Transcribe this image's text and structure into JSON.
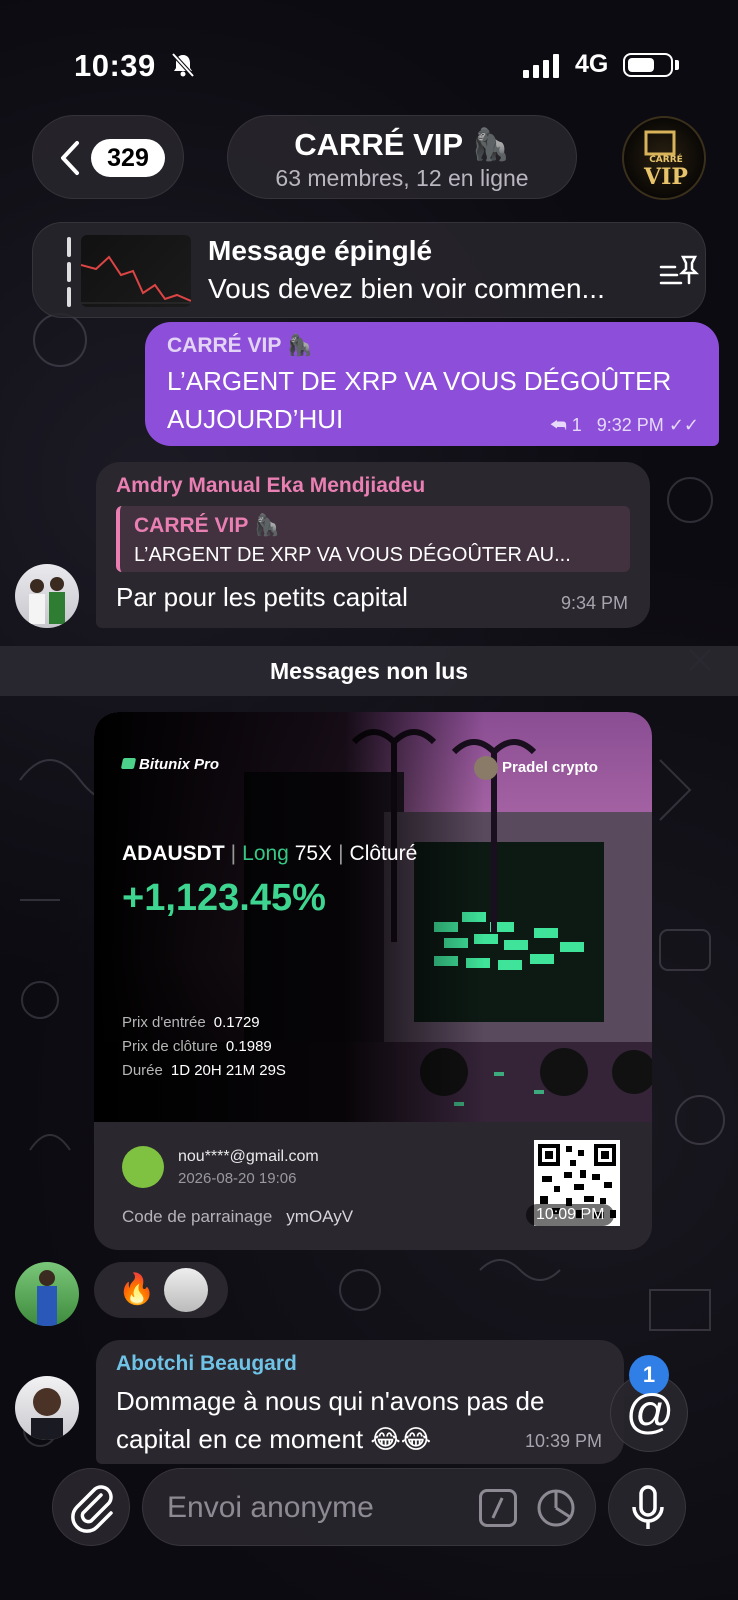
{
  "status_bar": {
    "time": "10:39",
    "network": "4G"
  },
  "header": {
    "back_count": "329",
    "title": "CARRÉ VIP",
    "subtitle": "63 membres, 12 en ligne",
    "avatar_text": "CARRÉ VIP"
  },
  "pinned": {
    "label": "Message épinglé",
    "preview": "Vous devez bien voir commen..."
  },
  "messages": {
    "m1": {
      "sender": "CARRÉ VIP",
      "text_line1": "L’ARGENT DE XRP VA VOUS DÉGOÛTER",
      "text_line2": "AUJOURD’HUI",
      "replies": "1",
      "time": "9:32 PM"
    },
    "m2": {
      "sender": "Amdry Manual Eka Mendjiadeu",
      "quote_sender": "CARRÉ VIP",
      "quote_text": "L’ARGENT DE XRP VA VOUS DÉGOÛTER AU...",
      "text": "Par pour les petits capital",
      "time": "9:34 PM"
    },
    "unread_label": "Messages non lus",
    "card": {
      "brand": "Bitunix Pro",
      "user": "Pradel crypto",
      "pair": "ADAUSDT",
      "direction": "Long",
      "leverage": "75X",
      "status": "Clôturé",
      "pnl": "+1,123.45%",
      "entry_label": "Prix d'entrée",
      "entry_value": "0.1729",
      "close_label": "Prix de clôture",
      "close_value": "0.1989",
      "duration_label": "Durée",
      "duration_value": "1D 20H 21M 29S",
      "email": "nou****@gmail.com",
      "date": "2026-08-20 19:06",
      "ref_label": "Code de parrainage",
      "ref_code": "ymOAyV",
      "time": "10:09 PM",
      "reaction": "🔥"
    },
    "m3": {
      "sender": "Abotchi Beaugard",
      "text_line1": "Dommage à nous qui n'avons pas de",
      "text_line2": "capital en ce moment 😂😂",
      "time": "10:39 PM"
    }
  },
  "mention_badge": "1",
  "composer": {
    "placeholder": "Envoi anonyme"
  },
  "colors": {
    "accent_purple": "#8d4fd9",
    "pnl_green": "#3ed590",
    "name_pink": "#e97fb2",
    "name_blue": "#6ec3e6",
    "badge_blue": "#2f7fe6"
  }
}
